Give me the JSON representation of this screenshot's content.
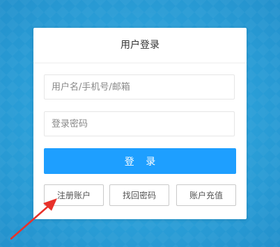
{
  "login": {
    "title": "用户登录",
    "username_placeholder": "用户名/手机号/邮箱",
    "password_placeholder": "登录密码",
    "submit_label": "登 录",
    "register_label": "注册账户",
    "forgot_label": "找回密码",
    "recharge_label": "账户充值"
  },
  "colors": {
    "background": "#2a9fd8",
    "primary": "#1e9fff",
    "annotation_arrow": "#e8312a"
  }
}
